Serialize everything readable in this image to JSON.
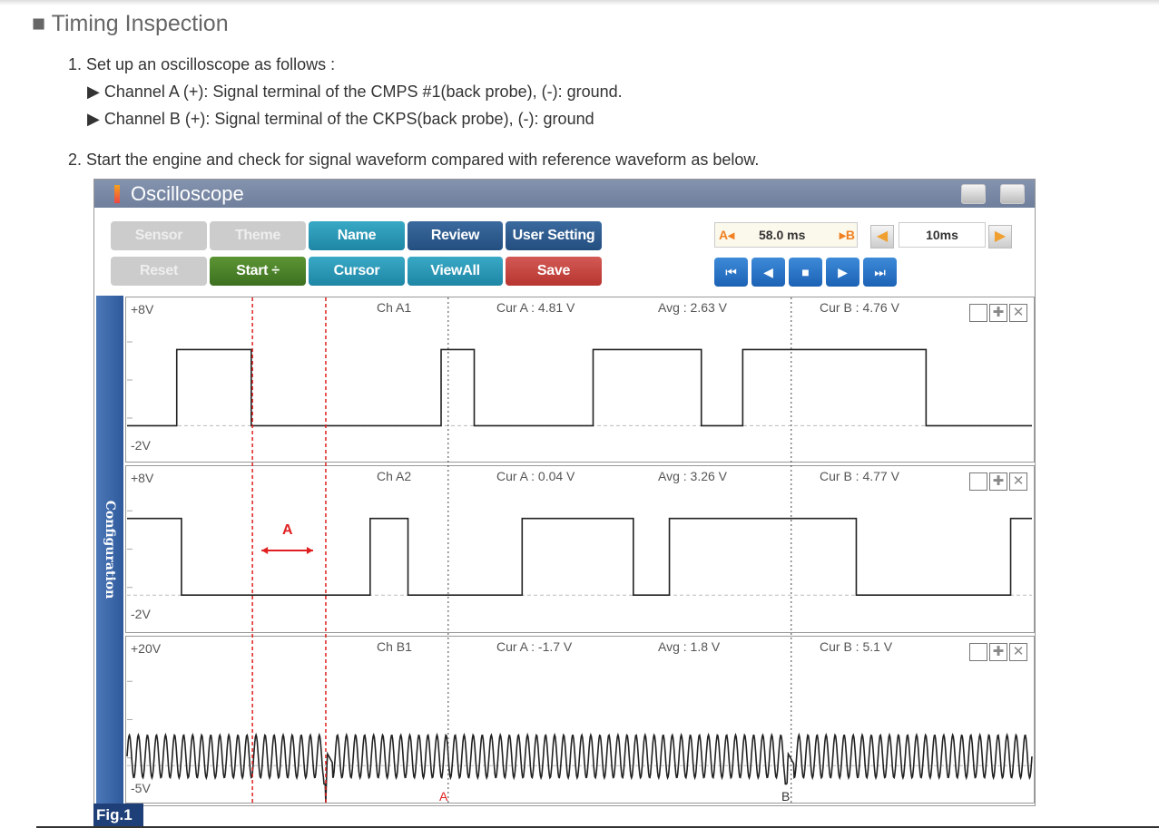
{
  "heading": "Timing Inspection",
  "steps": [
    "1. Set up an oscilloscope as follows :",
    "▶ Channel A (+): Signal terminal of the CMPS #1(back probe), (-): ground.",
    "▶ Channel B (+): Signal terminal of the CKPS(back probe), (-): ground",
    "2. Start the engine and check for signal waveform compared with reference waveform as below."
  ],
  "window": {
    "title": "Oscilloscope"
  },
  "buttons": {
    "sensor": "Sensor",
    "theme": "Theme",
    "name": "Name",
    "review": "Review",
    "user_setting": "User Setting",
    "reset": "Reset",
    "start": "Start ÷",
    "cursor": "Cursor",
    "viewall": "ViewAll",
    "save": "Save"
  },
  "cursor_box": {
    "a": "A◂",
    "value": "58.0 ms",
    "b": "▸B"
  },
  "timebase": "10ms",
  "sidebar": "Configuration",
  "channels": [
    {
      "name": "Ch A1",
      "top": "+8V",
      "bottom": "-2V",
      "cur_a": "Cur A : 4.81 V",
      "avg": "Avg : 2.63 V",
      "cur_b": "Cur B : 4.76 V"
    },
    {
      "name": "Ch A2",
      "top": "+8V",
      "bottom": "-2V",
      "cur_a": "Cur A : 0.04 V",
      "avg": "Avg : 3.26 V",
      "cur_b": "Cur B : 4.77 V"
    },
    {
      "name": "Ch B1",
      "top": "+20V",
      "bottom": "-5V",
      "cur_a": "Cur A : -1.7 V",
      "avg": "Avg : 1.8 V",
      "cur_b": "Cur B : 5.1 V"
    }
  ],
  "annotation": "A",
  "cursor_labels": {
    "a": "A",
    "b": "B"
  },
  "figure": "Fig.1",
  "colors": {
    "cursor_red": "#e02020"
  },
  "chart_data": {
    "type": "line",
    "x_unit": "ms",
    "x_range": [
      0,
      153
    ],
    "cursor_a_ms": 54.3,
    "cursor_b_ms": 112.3,
    "red_marks_ms": [
      21.2,
      33.6
    ],
    "series": [
      {
        "name": "Ch A1",
        "ylim": [
          -2,
          8
        ],
        "high": 5,
        "low": 0,
        "start": "low",
        "edges_ms": [
          8.4,
          21.0,
          53.1,
          58.7,
          78.8,
          97.1,
          104.1,
          135.1
        ]
      },
      {
        "name": "Ch A2",
        "ylim": [
          -2,
          8
        ],
        "high": 5,
        "low": 0,
        "start": "high",
        "edges_ms": [
          9.2,
          41.1,
          47.5,
          66.8,
          85.6,
          91.7,
          123.3,
          149.4
        ]
      },
      {
        "name": "Ch B1",
        "ylim": [
          -5,
          20
        ],
        "min": -2,
        "max": 5,
        "period_ms": 1.53,
        "gaps_ms": [
          33.6,
          111.5
        ]
      }
    ]
  }
}
